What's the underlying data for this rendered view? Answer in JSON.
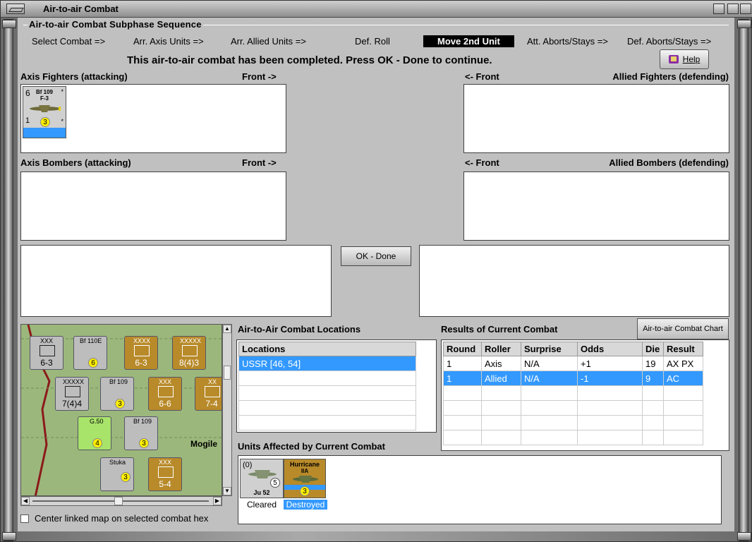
{
  "window": {
    "title": "Air-to-air Combat"
  },
  "subphase": {
    "header": "Air-to-air Combat Subphase Sequence",
    "steps": [
      "Select Combat =>",
      "Arr. Axis Units =>",
      "Arr. Allied Units =>",
      "Def. Roll",
      "Move 2nd Unit",
      "Att. Aborts/Stays =>",
      "Def. Aborts/Stays =>"
    ],
    "active_step": "Move 2nd Unit"
  },
  "banner": "This air-to-air combat has been completed.  Press OK - Done to continue.",
  "help_label": "Help",
  "panels": {
    "axis_fighters": "Axis Fighters (attacking)",
    "axis_bombers": "Axis Bombers (attacking)",
    "allied_fighters": "Allied Fighters (defending)",
    "allied_bombers": "Allied Bombers (defending)",
    "front_right": "Front ->",
    "front_left": "<- Front"
  },
  "axis_fighter_unit": {
    "left": "6",
    "name1": "Bf 109",
    "name2": "F-3",
    "bottom_left": "1",
    "range": "3",
    "star": "*"
  },
  "ok_label": "OK - Done",
  "map": {
    "scroll_up": "▲",
    "scroll_down": "▼",
    "scroll_left": "◀",
    "scroll_right": "▶",
    "hexes": [
      {
        "label": "XXX",
        "big": "6-3",
        "type": "axis"
      },
      {
        "label": "Bf 110E",
        "big": "6",
        "type": "axis"
      },
      {
        "label": "XXXX",
        "big": "6-3",
        "type": "sov"
      },
      {
        "label": "XXXXX",
        "big": "8(4)3",
        "type": "sov"
      },
      {
        "label": "XXXXX",
        "big": "7(4)4",
        "type": "axis"
      },
      {
        "label": "Bf 109",
        "big": "3",
        "type": "axis"
      },
      {
        "label": "XXX",
        "big": "6-6",
        "type": "sov"
      },
      {
        "label": "XX",
        "big": "7-4",
        "type": "sov"
      },
      {
        "label": "G.50",
        "big": "4",
        "type": "green"
      },
      {
        "label": "Bf 109",
        "big": "3",
        "type": "axis"
      },
      {
        "label": "Stuka",
        "big": "3",
        "type": "axis"
      },
      {
        "label": "XXX",
        "big": "5-4",
        "type": "sov"
      }
    ],
    "place": "Mogile"
  },
  "center_map_label": "Center linked map on selected combat hex",
  "locations": {
    "title": "Air-to-Air Combat Locations",
    "header": "Locations",
    "rows": [
      "USSR [46, 54]"
    ]
  },
  "results": {
    "title": "Results of Current Combat",
    "chart_button": "Air-to-air Combat Chart",
    "headers": [
      "Round",
      "Roller",
      "Surprise",
      "Odds",
      "Die",
      "Result"
    ],
    "rows": [
      [
        "1",
        "Axis",
        "N/A",
        "+1",
        "19",
        "AX PX"
      ],
      [
        "1",
        "Allied",
        "N/A",
        "-1",
        "9",
        "AC"
      ]
    ]
  },
  "affected": {
    "title": "Units Affected by Current Combat",
    "units": [
      {
        "name": "Ju 52",
        "top_left": "(0)",
        "range": "5",
        "caption": "Cleared"
      },
      {
        "name": "Hurricane",
        "sub": "IIA",
        "range": "3",
        "caption": "Destroyed"
      }
    ]
  },
  "colors": {
    "selection": "#3399ff",
    "soviet_counter": "#b88a2a",
    "panel_bg": "#c0c0c0"
  }
}
